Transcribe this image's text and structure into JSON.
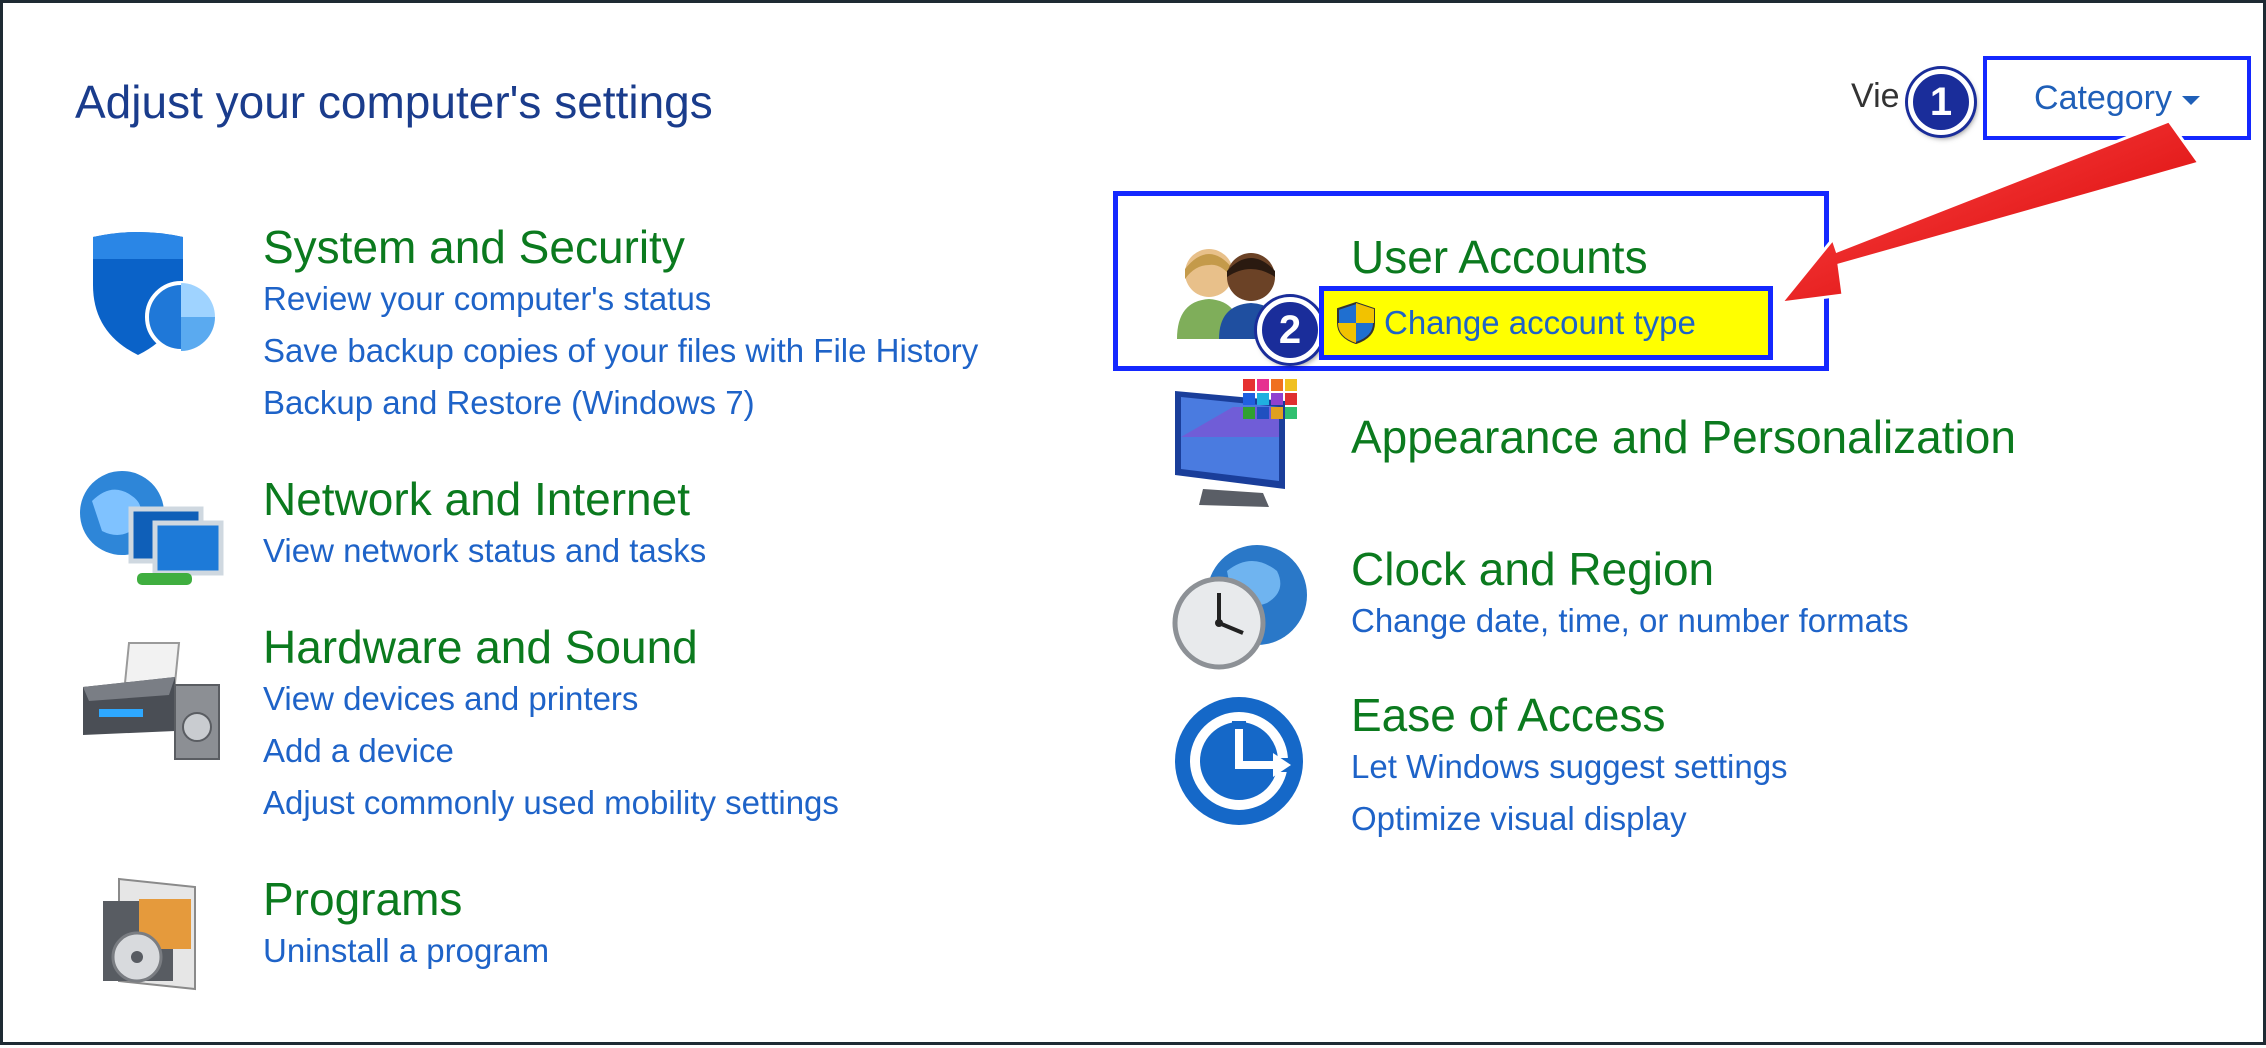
{
  "page": {
    "title": "Adjust your computer's settings",
    "view_by_label": "Vie",
    "view_by_value": "Category"
  },
  "annotations": {
    "step1": "1",
    "step2": "2",
    "highlight_color": "#ffff00",
    "box_color": "#1428ff",
    "arrow_color": "#ff1a1a"
  },
  "categories_left": [
    {
      "title": "System and Security",
      "icon": "shield-icon",
      "links": [
        "Review your computer's status",
        "Save backup copies of your files with File History",
        "Backup and Restore (Windows 7)"
      ]
    },
    {
      "title": "Network and Internet",
      "icon": "network-icon",
      "links": [
        "View network status and tasks"
      ]
    },
    {
      "title": "Hardware and Sound",
      "icon": "printer-icon",
      "links": [
        "View devices and printers",
        "Add a device",
        "Adjust commonly used mobility settings"
      ]
    },
    {
      "title": "Programs",
      "icon": "programs-icon",
      "links": [
        "Uninstall a program"
      ]
    }
  ],
  "categories_right": [
    {
      "title": "User Accounts",
      "icon": "users-icon",
      "links": [
        "Change account type"
      ]
    },
    {
      "title": "Appearance and Personalization",
      "icon": "monitor-icon",
      "links": []
    },
    {
      "title": "Clock and Region",
      "icon": "clock-globe-icon",
      "links": [
        "Change date, time, or number formats"
      ]
    },
    {
      "title": "Ease of Access",
      "icon": "ease-of-access-icon",
      "links": [
        "Let Windows suggest settings",
        "Optimize visual display"
      ]
    }
  ]
}
